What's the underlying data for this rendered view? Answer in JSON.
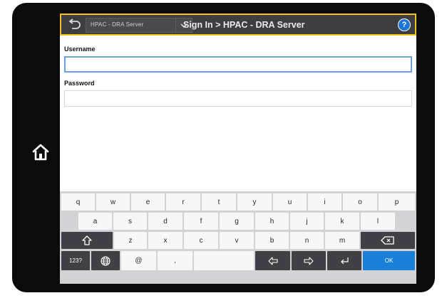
{
  "header": {
    "breadcrumb_label": "HPAC - DRA Server",
    "title": "Sign In > HPAC - DRA Server",
    "help_label": "?"
  },
  "form": {
    "username_label": "Username",
    "username_value": "",
    "password_label": "Password",
    "password_value": ""
  },
  "keyboard": {
    "row1": [
      "q",
      "w",
      "e",
      "r",
      "t",
      "y",
      "u",
      "i",
      "o",
      "p"
    ],
    "row2": [
      "a",
      "s",
      "d",
      "f",
      "g",
      "h",
      "j",
      "k",
      "l"
    ],
    "row3": [
      "z",
      "x",
      "c",
      "v",
      "b",
      "n",
      "m"
    ],
    "numeric_label": "123?",
    "at_label": "@",
    "comma_label": ",",
    "ok_label": "OK"
  },
  "icons": [
    "home-icon",
    "back-icon",
    "chevron-down-icon",
    "help-icon",
    "shift-icon",
    "backspace-icon",
    "globe-icon",
    "arrow-left-icon",
    "arrow-right-icon",
    "enter-icon"
  ],
  "colors": {
    "accent": "#1a7fd6",
    "header_bg": "#3d3d42",
    "header_border": "#f0c41a",
    "bezel": "#0b0b0b"
  }
}
